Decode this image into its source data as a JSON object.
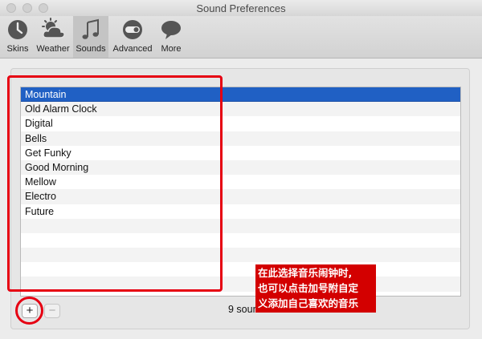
{
  "window": {
    "title": "Sound Preferences"
  },
  "toolbar": {
    "items": [
      {
        "label": "Skins",
        "icon": "clock-icon"
      },
      {
        "label": "Weather",
        "icon": "weather-icon"
      },
      {
        "label": "Sounds",
        "icon": "music-note-icon",
        "selected": true
      },
      {
        "label": "Advanced",
        "icon": "toggle-icon"
      },
      {
        "label": "More",
        "icon": "speech-bubble-icon"
      }
    ]
  },
  "sounds": {
    "items": [
      "Mountain",
      "Old Alarm Clock",
      "Digital",
      "Bells",
      "Get Funky",
      "Good Morning",
      "Mellow",
      "Electro",
      "Future"
    ],
    "selected": "Mountain",
    "count_label": "9 sounds"
  },
  "controls": {
    "add": "+",
    "remove": "−"
  },
  "annotation": {
    "lines": [
      "在此选择音乐闹钟时,",
      "也可以点击加号附自定",
      "义添加自己喜欢的音乐"
    ]
  },
  "colors": {
    "selection": "#2060c4",
    "annotation_red": "#e60012"
  }
}
